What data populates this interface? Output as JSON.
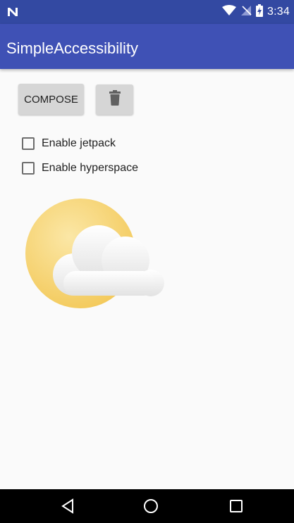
{
  "status_bar": {
    "time": "3:34",
    "icons": [
      "n-logo-icon",
      "wifi-icon",
      "no-sim-icon",
      "battery-charging-icon"
    ],
    "background": "#3349a2"
  },
  "app_bar": {
    "title": "SimpleAccessibility",
    "background": "#3f51b5"
  },
  "toolbar": {
    "compose_label": "COMPOSE",
    "delete_icon": "trash-icon"
  },
  "options": [
    {
      "label": "Enable jetpack",
      "checked": false
    },
    {
      "label": "Enable hyperspace",
      "checked": false
    }
  ],
  "illustration": {
    "icon": "partly-cloudy-icon",
    "sun_color": "#f6cf5f",
    "cloud_color": "#ececec"
  },
  "nav_bar": {
    "buttons": [
      "back-icon",
      "home-icon",
      "recents-icon"
    ]
  }
}
